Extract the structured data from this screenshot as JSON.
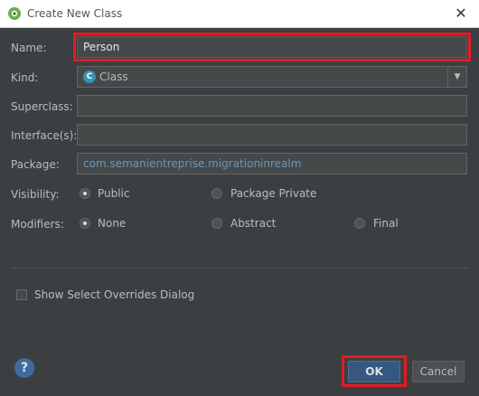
{
  "window": {
    "title": "Create New Class",
    "close_label": "✕"
  },
  "form": {
    "name_label": "Name:",
    "name_value": "Person",
    "kind_label": "Kind:",
    "kind_value": "Class",
    "kind_icon_letter": "C",
    "superclass_label": "Superclass:",
    "superclass_value": "",
    "interfaces_label": "Interface(s):",
    "interfaces_value": "",
    "package_label": "Package:",
    "package_value": "com.semanientreprise.migrationinrealm",
    "visibility_label": "Visibility:",
    "visibility_options": [
      {
        "label": "Public",
        "checked": true
      },
      {
        "label": "Package Private",
        "checked": false
      }
    ],
    "modifiers_label": "Modifiers:",
    "modifier_options": [
      {
        "label": "None",
        "checked": true
      },
      {
        "label": "Abstract",
        "checked": false
      },
      {
        "label": "Final",
        "checked": false
      }
    ],
    "overrides_label": "Show Select Overrides Dialog",
    "overrides_checked": false
  },
  "buttons": {
    "help": "?",
    "ok": "OK",
    "cancel": "Cancel"
  },
  "colors": {
    "highlight": "#e21b24",
    "accent": "#365880",
    "package_text": "#6897bb"
  }
}
